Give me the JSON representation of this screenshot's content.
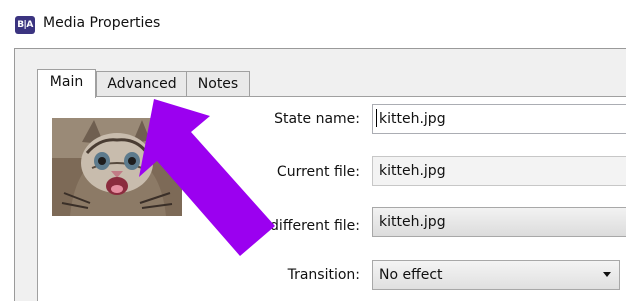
{
  "window": {
    "icon_text": "B|A",
    "title": "Media Properties"
  },
  "tabs": [
    {
      "label": "Main",
      "active": true
    },
    {
      "label": "Advanced",
      "active": false
    },
    {
      "label": "Notes",
      "active": false
    }
  ],
  "form": {
    "state_name": {
      "label": "State name:",
      "value": "kitteh.jpg"
    },
    "current_file": {
      "label": "Current file:",
      "value": "kitteh.jpg"
    },
    "select_file": {
      "label": "Select different file:",
      "value": "kitteh.jpg"
    },
    "transition": {
      "label": "Transition:",
      "value": "No effect"
    }
  },
  "colors": {
    "annotation_arrow": "#9b00f0",
    "app_icon": "#3b3480"
  },
  "icons": {
    "app": "media-app-icon",
    "thumbnail": "kitten-thumbnail",
    "annotation": "pointer-arrow-annotation",
    "dropdown": "chevron-down-icon"
  }
}
